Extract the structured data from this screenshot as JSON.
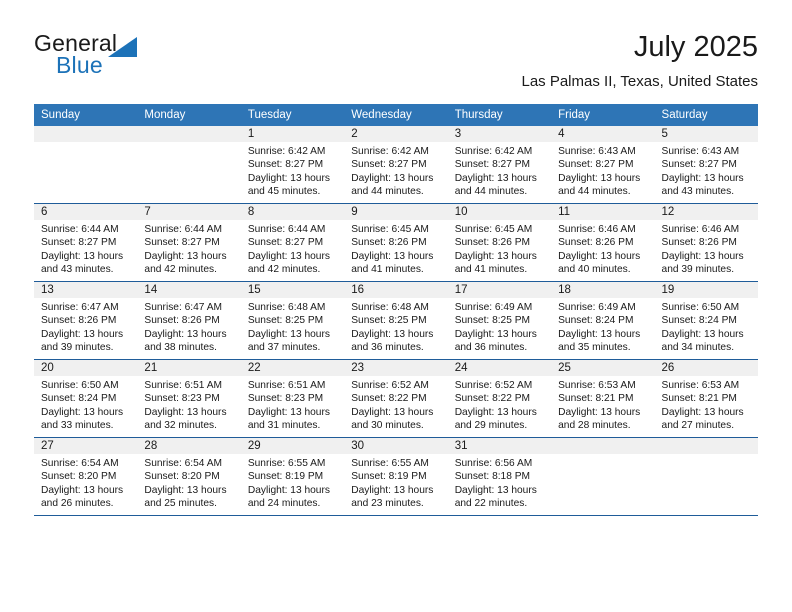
{
  "brand": {
    "name_part1": "General",
    "name_part2": "Blue",
    "accent_color": "#1c72b8"
  },
  "header": {
    "month_title": "July 2025",
    "location": "Las Palmas II, Texas, United States",
    "header_bg_color": "#2e75b6",
    "grid_line_color": "#1f5c99",
    "daynum_bg_color": "#f0f0f0"
  },
  "weekday_headers": [
    "Sunday",
    "Monday",
    "Tuesday",
    "Wednesday",
    "Thursday",
    "Friday",
    "Saturday"
  ],
  "weeks": [
    [
      {
        "day": "",
        "sunrise": "",
        "sunset": "",
        "daylight_line1": "",
        "daylight_line2": "",
        "empty": true
      },
      {
        "day": "",
        "sunrise": "",
        "sunset": "",
        "daylight_line1": "",
        "daylight_line2": "",
        "empty": true
      },
      {
        "day": "1",
        "sunrise": "Sunrise: 6:42 AM",
        "sunset": "Sunset: 8:27 PM",
        "daylight_line1": "Daylight: 13 hours",
        "daylight_line2": "and 45 minutes.",
        "empty": false
      },
      {
        "day": "2",
        "sunrise": "Sunrise: 6:42 AM",
        "sunset": "Sunset: 8:27 PM",
        "daylight_line1": "Daylight: 13 hours",
        "daylight_line2": "and 44 minutes.",
        "empty": false
      },
      {
        "day": "3",
        "sunrise": "Sunrise: 6:42 AM",
        "sunset": "Sunset: 8:27 PM",
        "daylight_line1": "Daylight: 13 hours",
        "daylight_line2": "and 44 minutes.",
        "empty": false
      },
      {
        "day": "4",
        "sunrise": "Sunrise: 6:43 AM",
        "sunset": "Sunset: 8:27 PM",
        "daylight_line1": "Daylight: 13 hours",
        "daylight_line2": "and 44 minutes.",
        "empty": false
      },
      {
        "day": "5",
        "sunrise": "Sunrise: 6:43 AM",
        "sunset": "Sunset: 8:27 PM",
        "daylight_line1": "Daylight: 13 hours",
        "daylight_line2": "and 43 minutes.",
        "empty": false
      }
    ],
    [
      {
        "day": "6",
        "sunrise": "Sunrise: 6:44 AM",
        "sunset": "Sunset: 8:27 PM",
        "daylight_line1": "Daylight: 13 hours",
        "daylight_line2": "and 43 minutes.",
        "empty": false
      },
      {
        "day": "7",
        "sunrise": "Sunrise: 6:44 AM",
        "sunset": "Sunset: 8:27 PM",
        "daylight_line1": "Daylight: 13 hours",
        "daylight_line2": "and 42 minutes.",
        "empty": false
      },
      {
        "day": "8",
        "sunrise": "Sunrise: 6:44 AM",
        "sunset": "Sunset: 8:27 PM",
        "daylight_line1": "Daylight: 13 hours",
        "daylight_line2": "and 42 minutes.",
        "empty": false
      },
      {
        "day": "9",
        "sunrise": "Sunrise: 6:45 AM",
        "sunset": "Sunset: 8:26 PM",
        "daylight_line1": "Daylight: 13 hours",
        "daylight_line2": "and 41 minutes.",
        "empty": false
      },
      {
        "day": "10",
        "sunrise": "Sunrise: 6:45 AM",
        "sunset": "Sunset: 8:26 PM",
        "daylight_line1": "Daylight: 13 hours",
        "daylight_line2": "and 41 minutes.",
        "empty": false
      },
      {
        "day": "11",
        "sunrise": "Sunrise: 6:46 AM",
        "sunset": "Sunset: 8:26 PM",
        "daylight_line1": "Daylight: 13 hours",
        "daylight_line2": "and 40 minutes.",
        "empty": false
      },
      {
        "day": "12",
        "sunrise": "Sunrise: 6:46 AM",
        "sunset": "Sunset: 8:26 PM",
        "daylight_line1": "Daylight: 13 hours",
        "daylight_line2": "and 39 minutes.",
        "empty": false
      }
    ],
    [
      {
        "day": "13",
        "sunrise": "Sunrise: 6:47 AM",
        "sunset": "Sunset: 8:26 PM",
        "daylight_line1": "Daylight: 13 hours",
        "daylight_line2": "and 39 minutes.",
        "empty": false
      },
      {
        "day": "14",
        "sunrise": "Sunrise: 6:47 AM",
        "sunset": "Sunset: 8:26 PM",
        "daylight_line1": "Daylight: 13 hours",
        "daylight_line2": "and 38 minutes.",
        "empty": false
      },
      {
        "day": "15",
        "sunrise": "Sunrise: 6:48 AM",
        "sunset": "Sunset: 8:25 PM",
        "daylight_line1": "Daylight: 13 hours",
        "daylight_line2": "and 37 minutes.",
        "empty": false
      },
      {
        "day": "16",
        "sunrise": "Sunrise: 6:48 AM",
        "sunset": "Sunset: 8:25 PM",
        "daylight_line1": "Daylight: 13 hours",
        "daylight_line2": "and 36 minutes.",
        "empty": false
      },
      {
        "day": "17",
        "sunrise": "Sunrise: 6:49 AM",
        "sunset": "Sunset: 8:25 PM",
        "daylight_line1": "Daylight: 13 hours",
        "daylight_line2": "and 36 minutes.",
        "empty": false
      },
      {
        "day": "18",
        "sunrise": "Sunrise: 6:49 AM",
        "sunset": "Sunset: 8:24 PM",
        "daylight_line1": "Daylight: 13 hours",
        "daylight_line2": "and 35 minutes.",
        "empty": false
      },
      {
        "day": "19",
        "sunrise": "Sunrise: 6:50 AM",
        "sunset": "Sunset: 8:24 PM",
        "daylight_line1": "Daylight: 13 hours",
        "daylight_line2": "and 34 minutes.",
        "empty": false
      }
    ],
    [
      {
        "day": "20",
        "sunrise": "Sunrise: 6:50 AM",
        "sunset": "Sunset: 8:24 PM",
        "daylight_line1": "Daylight: 13 hours",
        "daylight_line2": "and 33 minutes.",
        "empty": false
      },
      {
        "day": "21",
        "sunrise": "Sunrise: 6:51 AM",
        "sunset": "Sunset: 8:23 PM",
        "daylight_line1": "Daylight: 13 hours",
        "daylight_line2": "and 32 minutes.",
        "empty": false
      },
      {
        "day": "22",
        "sunrise": "Sunrise: 6:51 AM",
        "sunset": "Sunset: 8:23 PM",
        "daylight_line1": "Daylight: 13 hours",
        "daylight_line2": "and 31 minutes.",
        "empty": false
      },
      {
        "day": "23",
        "sunrise": "Sunrise: 6:52 AM",
        "sunset": "Sunset: 8:22 PM",
        "daylight_line1": "Daylight: 13 hours",
        "daylight_line2": "and 30 minutes.",
        "empty": false
      },
      {
        "day": "24",
        "sunrise": "Sunrise: 6:52 AM",
        "sunset": "Sunset: 8:22 PM",
        "daylight_line1": "Daylight: 13 hours",
        "daylight_line2": "and 29 minutes.",
        "empty": false
      },
      {
        "day": "25",
        "sunrise": "Sunrise: 6:53 AM",
        "sunset": "Sunset: 8:21 PM",
        "daylight_line1": "Daylight: 13 hours",
        "daylight_line2": "and 28 minutes.",
        "empty": false
      },
      {
        "day": "26",
        "sunrise": "Sunrise: 6:53 AM",
        "sunset": "Sunset: 8:21 PM",
        "daylight_line1": "Daylight: 13 hours",
        "daylight_line2": "and 27 minutes.",
        "empty": false
      }
    ],
    [
      {
        "day": "27",
        "sunrise": "Sunrise: 6:54 AM",
        "sunset": "Sunset: 8:20 PM",
        "daylight_line1": "Daylight: 13 hours",
        "daylight_line2": "and 26 minutes.",
        "empty": false
      },
      {
        "day": "28",
        "sunrise": "Sunrise: 6:54 AM",
        "sunset": "Sunset: 8:20 PM",
        "daylight_line1": "Daylight: 13 hours",
        "daylight_line2": "and 25 minutes.",
        "empty": false
      },
      {
        "day": "29",
        "sunrise": "Sunrise: 6:55 AM",
        "sunset": "Sunset: 8:19 PM",
        "daylight_line1": "Daylight: 13 hours",
        "daylight_line2": "and 24 minutes.",
        "empty": false
      },
      {
        "day": "30",
        "sunrise": "Sunrise: 6:55 AM",
        "sunset": "Sunset: 8:19 PM",
        "daylight_line1": "Daylight: 13 hours",
        "daylight_line2": "and 23 minutes.",
        "empty": false
      },
      {
        "day": "31",
        "sunrise": "Sunrise: 6:56 AM",
        "sunset": "Sunset: 8:18 PM",
        "daylight_line1": "Daylight: 13 hours",
        "daylight_line2": "and 22 minutes.",
        "empty": false
      },
      {
        "day": "",
        "sunrise": "",
        "sunset": "",
        "daylight_line1": "",
        "daylight_line2": "",
        "empty": true
      },
      {
        "day": "",
        "sunrise": "",
        "sunset": "",
        "daylight_line1": "",
        "daylight_line2": "",
        "empty": true
      }
    ]
  ]
}
